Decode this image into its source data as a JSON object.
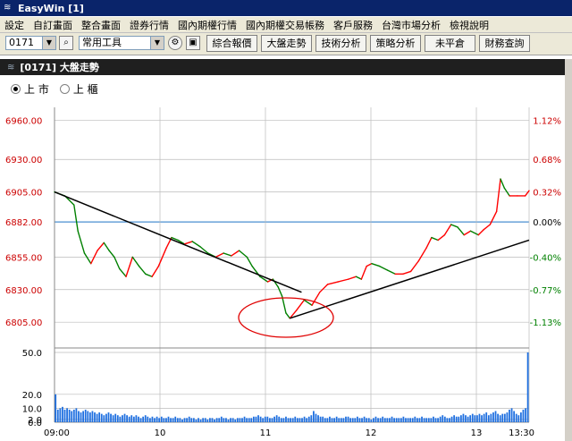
{
  "window": {
    "title": "EasyWin  [1]"
  },
  "menu": [
    "設定",
    "自訂畫面",
    "整合畫面",
    "證券行情",
    "國內期權行情",
    "國內期權交易帳務",
    "客戶服務",
    "台灣市場分析",
    "檢視說明"
  ],
  "toolbar": {
    "symbol": "0171",
    "tool_select": "常用工具",
    "buttons": [
      "綜合報價",
      "大盤走勢",
      "技術分析",
      "策略分析",
      "未平倉",
      "財務查詢"
    ]
  },
  "panel": {
    "title": "[0171] 大盤走勢"
  },
  "market": {
    "options": [
      "上 市",
      "上 櫃"
    ],
    "selected": 0
  },
  "colors": {
    "up": "#ff0000",
    "down": "#008000",
    "ref": "#4a8fd0",
    "grid": "#bbbbbb"
  },
  "chart_data": {
    "type": "line",
    "y_ticks": [
      "6960.00",
      "6930.00",
      "6905.00",
      "6882.00",
      "6855.00",
      "6830.00",
      "6805.00"
    ],
    "y_values": [
      6960,
      6930,
      6905,
      6882,
      6855,
      6830,
      6805
    ],
    "pct_ticks": [
      "1.12%",
      "0.68%",
      "0.32%",
      "0.00%",
      "-0.40%",
      "-0.77%",
      "-1.13%"
    ],
    "volume_ticks": [
      "50.0",
      "20.0",
      "10.0",
      "2.0",
      "0.0"
    ],
    "x_ticks": [
      "09:00",
      "10",
      "11",
      "12",
      "13",
      "13:30"
    ],
    "ylim": [
      6790,
      6970
    ],
    "reference": 6882,
    "price_series": [
      [
        0,
        6905
      ],
      [
        8,
        6902
      ],
      [
        15,
        6895
      ],
      [
        18,
        6875
      ],
      [
        23,
        6858
      ],
      [
        28,
        6850
      ],
      [
        33,
        6860
      ],
      [
        38,
        6866
      ],
      [
        42,
        6860
      ],
      [
        46,
        6855
      ],
      [
        50,
        6846
      ],
      [
        55,
        6840
      ],
      [
        60,
        6855
      ],
      [
        65,
        6848
      ],
      [
        70,
        6842
      ],
      [
        75,
        6840
      ],
      [
        80,
        6848
      ],
      [
        86,
        6862
      ],
      [
        90,
        6870
      ],
      [
        95,
        6868
      ],
      [
        100,
        6865
      ],
      [
        106,
        6867
      ],
      [
        112,
        6863
      ],
      [
        118,
        6858
      ],
      [
        124,
        6855
      ],
      [
        130,
        6858
      ],
      [
        136,
        6856
      ],
      [
        142,
        6860
      ],
      [
        148,
        6855
      ],
      [
        152,
        6848
      ],
      [
        158,
        6840
      ],
      [
        164,
        6836
      ],
      [
        168,
        6838
      ],
      [
        172,
        6832
      ],
      [
        175,
        6825
      ],
      [
        178,
        6812
      ],
      [
        181,
        6808
      ],
      [
        186,
        6814
      ],
      [
        192,
        6822
      ],
      [
        198,
        6818
      ],
      [
        204,
        6828
      ],
      [
        210,
        6834
      ],
      [
        218,
        6836
      ],
      [
        226,
        6838
      ],
      [
        232,
        6840
      ],
      [
        236,
        6838
      ],
      [
        240,
        6848
      ],
      [
        244,
        6850
      ],
      [
        250,
        6848
      ],
      [
        256,
        6845
      ],
      [
        262,
        6842
      ],
      [
        268,
        6842
      ],
      [
        274,
        6844
      ],
      [
        280,
        6852
      ],
      [
        286,
        6862
      ],
      [
        290,
        6870
      ],
      [
        295,
        6868
      ],
      [
        300,
        6872
      ],
      [
        305,
        6880
      ],
      [
        310,
        6878
      ],
      [
        315,
        6872
      ],
      [
        320,
        6875
      ],
      [
        326,
        6872
      ],
      [
        330,
        6876
      ],
      [
        335,
        6880
      ],
      [
        340,
        6890
      ],
      [
        343,
        6915
      ],
      [
        346,
        6908
      ],
      [
        350,
        6902
      ],
      [
        356,
        6902
      ],
      [
        362,
        6902
      ],
      [
        365,
        6906
      ]
    ],
    "volume": [
      20,
      9,
      10,
      11,
      9,
      10,
      9,
      8,
      9,
      10,
      8,
      7,
      8,
      9,
      8,
      7,
      8,
      7,
      6,
      7,
      6,
      5,
      6,
      7,
      6,
      5,
      6,
      5,
      4,
      5,
      6,
      5,
      4,
      5,
      4,
      5,
      4,
      3,
      4,
      5,
      4,
      3,
      4,
      3,
      4,
      3,
      4,
      3,
      3,
      4,
      3,
      3,
      4,
      3,
      3,
      2,
      3,
      3,
      4,
      3,
      3,
      2,
      3,
      2,
      3,
      3,
      2,
      3,
      3,
      2,
      3,
      3,
      4,
      3,
      3,
      2,
      3,
      3,
      2,
      3,
      3,
      3,
      4,
      3,
      3,
      3,
      4,
      4,
      5,
      4,
      3,
      4,
      4,
      3,
      3,
      4,
      5,
      4,
      3,
      3,
      4,
      3,
      3,
      3,
      4,
      3,
      3,
      3,
      4,
      3,
      4,
      5,
      8,
      6,
      5,
      4,
      4,
      3,
      3,
      4,
      3,
      3,
      4,
      3,
      3,
      3,
      4,
      4,
      3,
      3,
      3,
      4,
      3,
      3,
      4,
      3,
      3,
      2,
      3,
      4,
      3,
      3,
      4,
      3,
      3,
      3,
      4,
      3,
      3,
      3,
      3,
      4,
      3,
      3,
      3,
      3,
      4,
      3,
      3,
      4,
      3,
      3,
      3,
      3,
      4,
      3,
      3,
      4,
      5,
      4,
      3,
      3,
      4,
      5,
      4,
      4,
      5,
      6,
      5,
      4,
      5,
      6,
      5,
      5,
      6,
      5,
      6,
      7,
      5,
      6,
      7,
      8,
      6,
      5,
      6,
      6,
      7,
      9,
      10,
      8,
      6,
      5,
      7,
      9,
      10,
      50
    ],
    "volume_max": 50,
    "trend_lines": [
      {
        "from": [
          0,
          6905
        ],
        "to": [
          190,
          6828
        ]
      },
      {
        "from": [
          181,
          6808
        ],
        "to": [
          365,
          6868
        ]
      }
    ]
  }
}
